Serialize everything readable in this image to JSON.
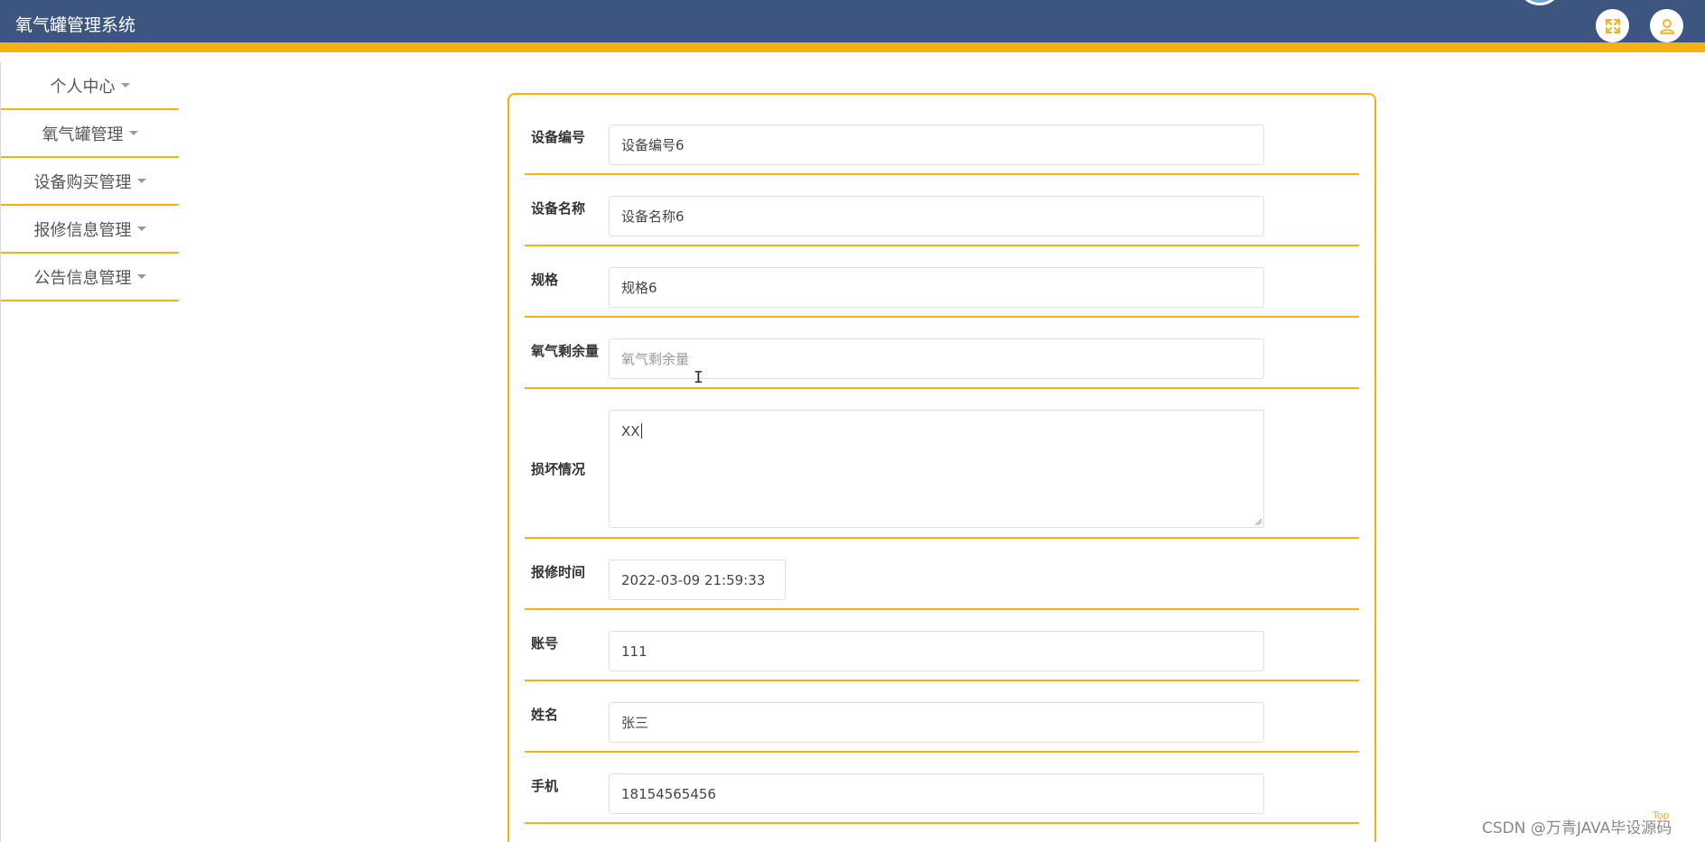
{
  "header": {
    "app_title": "氧气罐管理系统",
    "fullscreen_icon": "expand-icon",
    "user_icon": "user-icon",
    "bg_color": "#3d5680",
    "accent_color": "#f5b014"
  },
  "sidebar": {
    "items": [
      {
        "label": "个人中心"
      },
      {
        "label": "氧气罐管理"
      },
      {
        "label": "设备购买管理"
      },
      {
        "label": "报修信息管理"
      },
      {
        "label": "公告信息管理"
      }
    ]
  },
  "form": {
    "fields": [
      {
        "label": "设备编号",
        "value": "设备编号6"
      },
      {
        "label": "设备名称",
        "value": "设备名称6"
      },
      {
        "label": "规格",
        "value": "规格6"
      },
      {
        "label": "氧气剩余量",
        "value": "",
        "placeholder": "氧气剩余量"
      },
      {
        "label": "损坏情况",
        "value": "XX"
      },
      {
        "label": "报修时间",
        "value": "2022-03-09 21:59:33"
      },
      {
        "label": "账号",
        "value": "111"
      },
      {
        "label": "姓名",
        "value": "张三"
      },
      {
        "label": "手机",
        "value": "18154565456"
      }
    ]
  },
  "footer": {
    "watermark": "CSDN @万青JAVA毕设源码",
    "top_link": "Top"
  }
}
